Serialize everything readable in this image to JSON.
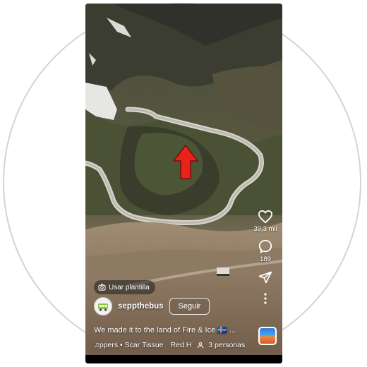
{
  "reel": {
    "template_button": "Usar plantilla",
    "username": "seppthebus",
    "follow_label": "Seguir",
    "caption": "We made it to the land of Fire & Ice 🇮🇸 ...",
    "audio": "♫ppers • Scar Tissue",
    "audio_extra": "Red H",
    "people": "3 personas"
  },
  "actions": {
    "likes": "39,3 mil",
    "comments": "189"
  },
  "annotation": {
    "arrow_color": "#e8231b"
  }
}
